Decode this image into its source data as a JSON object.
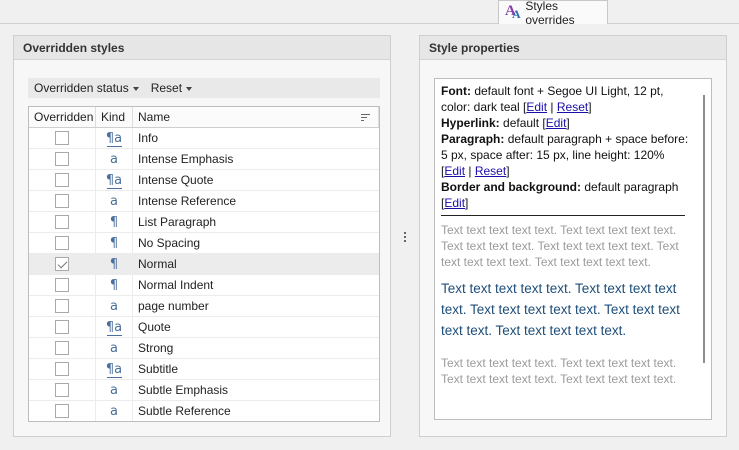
{
  "tab": {
    "label": "Styles overrides",
    "icon": "styles-overrides-icon"
  },
  "left_panel": {
    "title": "Overridden styles",
    "toolbar": {
      "status_label": "Overridden status",
      "reset_label": "Reset"
    },
    "columns": {
      "overridden": "Overridden",
      "kind": "Kind",
      "name": "Name"
    },
    "rows": [
      {
        "name": "Info",
        "kind": "linked",
        "glyph": "¶a",
        "checked": false
      },
      {
        "name": "Intense Emphasis",
        "kind": "character",
        "glyph": "a",
        "checked": false
      },
      {
        "name": "Intense Quote",
        "kind": "linked",
        "glyph": "¶a",
        "checked": false
      },
      {
        "name": "Intense Reference",
        "kind": "character",
        "glyph": "a",
        "checked": false
      },
      {
        "name": "List Paragraph",
        "kind": "paragraph",
        "glyph": "¶",
        "checked": false
      },
      {
        "name": "No Spacing",
        "kind": "paragraph",
        "glyph": "¶",
        "checked": false
      },
      {
        "name": "Normal",
        "kind": "paragraph",
        "glyph": "¶",
        "checked": true,
        "selected": true
      },
      {
        "name": "Normal Indent",
        "kind": "paragraph",
        "glyph": "¶",
        "checked": false
      },
      {
        "name": "page number",
        "kind": "character",
        "glyph": "a",
        "checked": false
      },
      {
        "name": "Quote",
        "kind": "linked",
        "glyph": "¶a",
        "checked": false
      },
      {
        "name": "Strong",
        "kind": "character",
        "glyph": "a",
        "checked": false
      },
      {
        "name": "Subtitle",
        "kind": "linked",
        "glyph": "¶a",
        "checked": false
      },
      {
        "name": "Subtle Emphasis",
        "kind": "character",
        "glyph": "a",
        "checked": false
      },
      {
        "name": "Subtle Reference",
        "kind": "character",
        "glyph": "a",
        "checked": false
      }
    ]
  },
  "right_panel": {
    "title": "Style properties",
    "font": {
      "label": "Font:",
      "value": "default font + Segoe UI Light, 12 pt, color: dark teal"
    },
    "hyperlink": {
      "label": "Hyperlink:",
      "value": "default"
    },
    "paragraph": {
      "label": "Paragraph:",
      "value": "default paragraph + space before: 5 px, space after: 15 px, line height: 120%"
    },
    "border": {
      "label": "Border and background:",
      "value": "default paragraph"
    },
    "links": {
      "edit": "Edit",
      "reset": "Reset"
    },
    "sample_before": "Text text text text text. Text text text text text. Text text text text. Text text text text text. Text text text text text. Text text text text text.",
    "sample_main": "Text text text text text. Text text text text text. Text text text text text. Text text text text text. Text text text text text.",
    "sample_after": "Text text text text text. Text text text text text. Text text text text text. Text text text text text."
  },
  "colors": {
    "kind_icon": "#4a6f9c",
    "sample_teal": "#1e4e79",
    "link": "#1a0dab"
  }
}
